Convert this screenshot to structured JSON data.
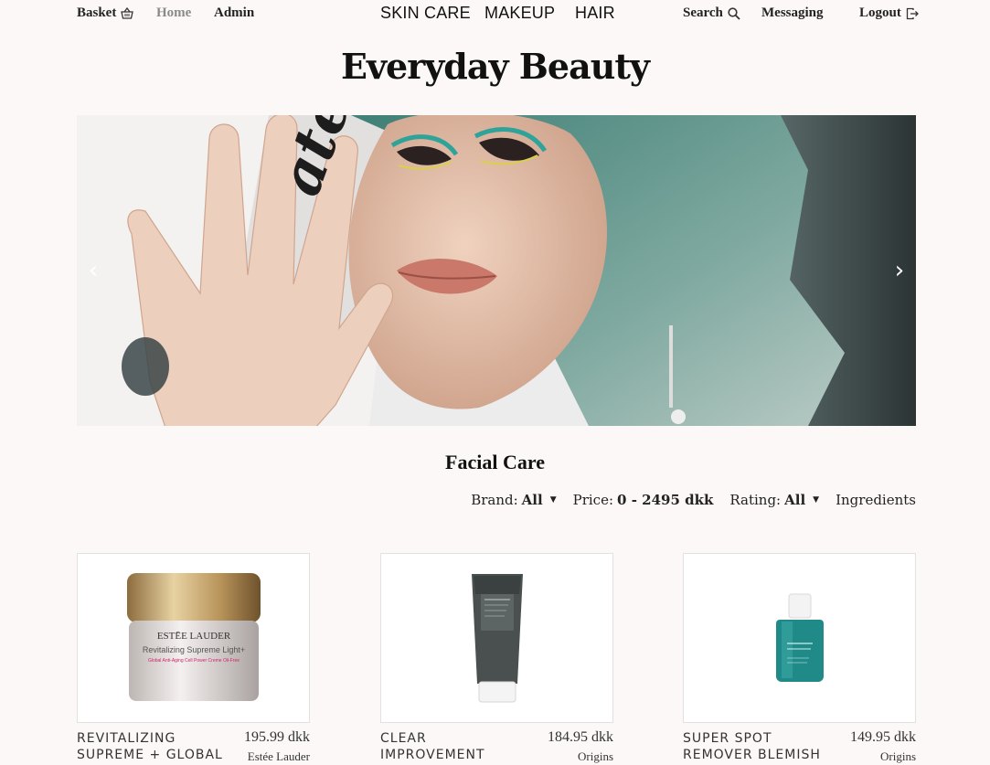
{
  "nav": {
    "basket": "Basket",
    "home": "Home",
    "admin": "Admin",
    "categories": [
      "SKIN CARE",
      "MAKEUP",
      "HAIR"
    ],
    "search": "Search",
    "messaging": "Messaging",
    "logout": "Logout"
  },
  "brand_title": "Everyday Beauty",
  "carousel": {
    "prev": "‹",
    "next": "›"
  },
  "section_title": "Facial Care",
  "filters": {
    "brand_label": "Brand:",
    "brand_value": "All",
    "price_label": "Price:",
    "price_value": "0 - 2495 dkk",
    "rating_label": "Rating:",
    "rating_value": "All",
    "ingredients": "Ingredients"
  },
  "products": [
    {
      "name": "REVITALIZING SUPREME + GLOBAL",
      "price": "195.99 dkk",
      "brand": "Estée Lauder"
    },
    {
      "name": "CLEAR IMPROVEMENT",
      "price": "184.95 dkk",
      "brand": "Origins"
    },
    {
      "name": "SUPER SPOT REMOVER BLEMISH",
      "price": "149.95 dkk",
      "brand": "Origins"
    }
  ],
  "product_label_text": {
    "jar_brand": "ESTĒE LAUDER",
    "jar_line1": "Revitalizing Supreme Light+",
    "jar_line2": "Global Anti-Aging Cell Power Creme Oil-Free"
  },
  "colors": {
    "background": "#fdf8f8",
    "accent_hair": "#4f8f86"
  }
}
